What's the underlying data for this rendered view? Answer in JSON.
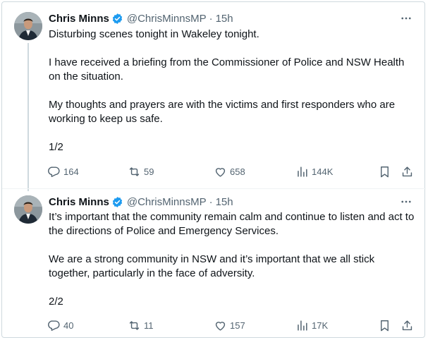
{
  "tweets": [
    {
      "name": "Chris Minns",
      "handle": "@ChrisMinnsMP",
      "separator": "·",
      "time": "15h",
      "paragraphs": [
        "Disturbing scenes tonight in Wakeley tonight.",
        "I have received a briefing from the Commissioner of Police and NSW Health on the situation.",
        "My thoughts and prayers are with the victims and first responders who are working to keep us safe.",
        "1/2"
      ],
      "replies": "164",
      "retweets": "59",
      "likes": "658",
      "views": "144K"
    },
    {
      "name": "Chris Minns",
      "handle": "@ChrisMinnsMP",
      "separator": "·",
      "time": "15h",
      "paragraphs": [
        "It’s important that the community remain calm and continue to listen and act to the directions of Police and Emergency Services.",
        "We are a strong community in NSW and it’s important that we all stick together, particularly in the face of adversity.",
        "2/2"
      ],
      "replies": "40",
      "retweets": "11",
      "likes": "157",
      "views": "17K"
    }
  ],
  "icons": {
    "verified": "verified-badge-icon",
    "more": "more-options-icon",
    "reply": "reply-icon",
    "retweet": "retweet-icon",
    "like": "heart-icon",
    "views": "views-chart-icon",
    "bookmark": "bookmark-icon",
    "share": "share-icon"
  },
  "colors": {
    "text": "#0f1419",
    "secondary": "#536471",
    "verified": "#1d9bf0",
    "border": "#cfd9de"
  }
}
